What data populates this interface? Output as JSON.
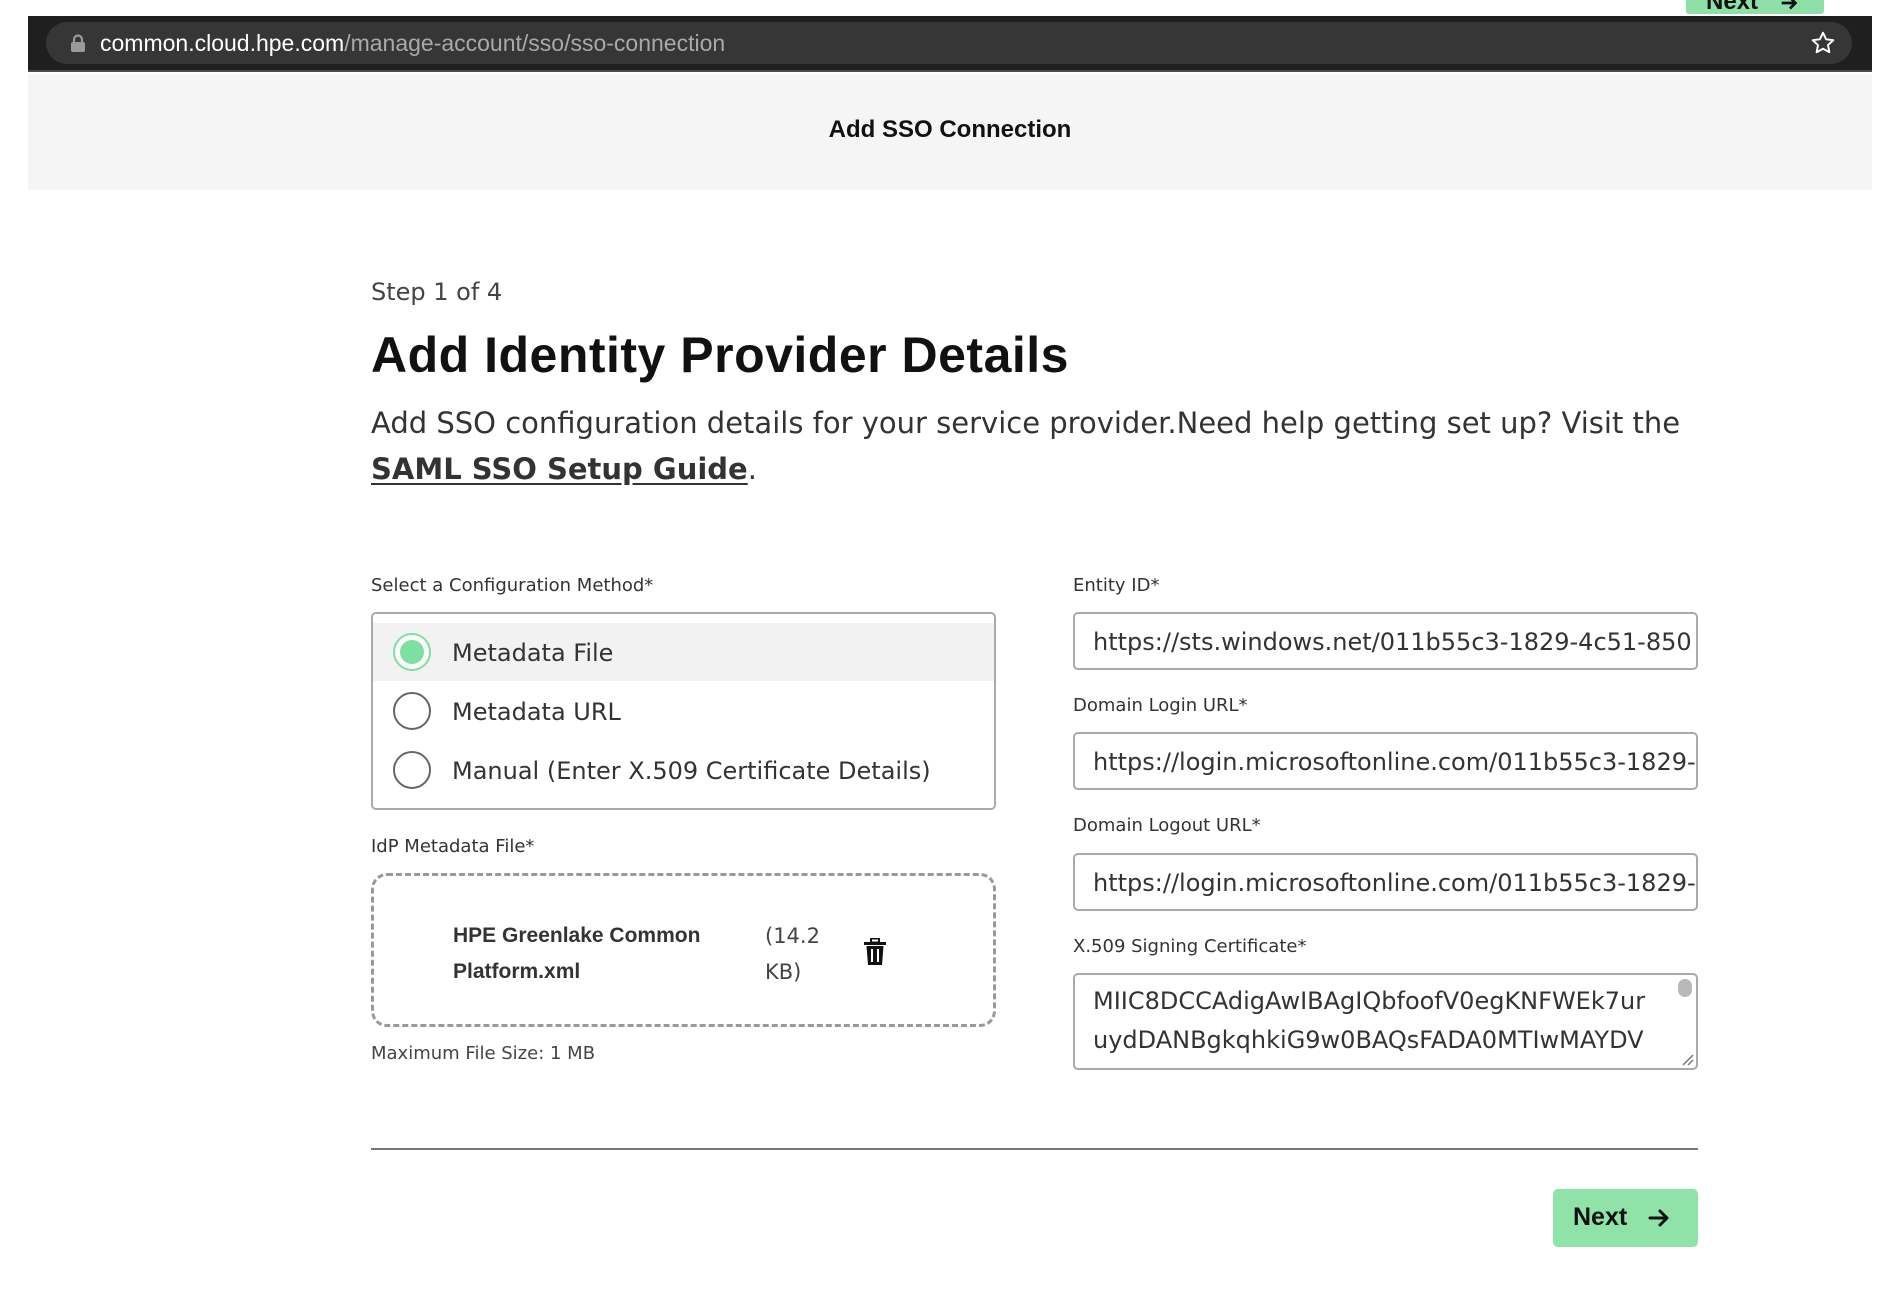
{
  "browser": {
    "url_host": "common.cloud.hpe.com",
    "url_path": "/manage-account/sso/sso-connection",
    "icons": [
      "lock-icon",
      "star-icon"
    ]
  },
  "top_peek_button": {
    "label": "Next"
  },
  "header": {
    "title": "Add SSO Connection"
  },
  "main": {
    "step": "Step 1 of 4",
    "title": "Add Identity Provider Details",
    "description": "Add SSO configuration details for your service provider.Need help getting set up? Visit the ",
    "guide_link": "SAML SSO Setup Guide",
    "description_end": "."
  },
  "config_method": {
    "label": "Select a Configuration Method*",
    "selected": "Metadata File",
    "options": [
      {
        "label": "Metadata File"
      },
      {
        "label": "Metadata URL"
      },
      {
        "label": "Manual (Enter X.509 Certificate Details)"
      }
    ]
  },
  "metadata_file": {
    "label": "IdP Metadata File*",
    "file_name": "HPE Greenlake Common Platform.xml",
    "file_size": "(14.2 KB)",
    "max_size": "Maximum File Size: 1 MB"
  },
  "fields": {
    "entity_id": {
      "label": "Entity ID*",
      "value": "https://sts.windows.net/011b55c3-1829-4c51-850"
    },
    "login_url": {
      "label": "Domain Login URL*",
      "value": "https://login.microsoftonline.com/011b55c3-1829-"
    },
    "logout_url": {
      "label": "Domain Logout URL*",
      "value": "https://login.microsoftonline.com/011b55c3-1829-"
    },
    "certificate": {
      "label": "X.509 Signing Certificate*",
      "lines": [
        "MIIC8DCCAdigAwIBAgIQbfoofV0egKNFWEk7ur",
        "uydDANBgkqhkiG9w0BAQsFADA0MTIwMAYDV"
      ]
    }
  },
  "footer": {
    "next_label": "Next"
  },
  "colors": {
    "accent": "#8fe3a9",
    "radio_selected": "#7ee0a0",
    "browser_bar": "#1f1f1f",
    "header_bg": "#f5f5f5"
  }
}
